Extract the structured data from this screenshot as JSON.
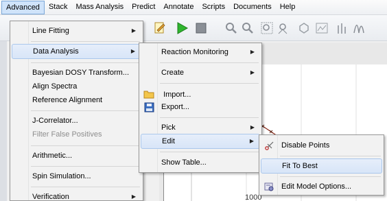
{
  "menubar": {
    "items": [
      "Advanced",
      "Stack",
      "Mass Analysis",
      "Predict",
      "Annotate",
      "Scripts",
      "Documents",
      "Help"
    ],
    "active": "Advanced"
  },
  "plot": {
    "y_tick_label": "1000"
  },
  "advanced_menu": {
    "items": [
      {
        "label": "Line Fitting"
      },
      {
        "label": "Data Analysis"
      },
      {
        "label": "Bayesian DOSY Transform..."
      },
      {
        "label": "Align Spectra"
      },
      {
        "label": "Reference Alignment"
      },
      {
        "label": "J-Correlator..."
      },
      {
        "label": "Filter False Positives",
        "disabled": true
      },
      {
        "label": "Arithmetic..."
      },
      {
        "label": "Spin Simulation..."
      },
      {
        "label": "Verification"
      }
    ]
  },
  "data_analysis_menu": {
    "items": [
      {
        "label": "Reaction Monitoring"
      },
      {
        "label": "Create"
      },
      {
        "label": "Import...",
        "icon": "folder-icon"
      },
      {
        "label": "Export...",
        "icon": "save-icon"
      },
      {
        "label": "Pick"
      },
      {
        "label": "Edit"
      },
      {
        "label": "Show Table..."
      }
    ]
  },
  "edit_menu": {
    "items": [
      {
        "label": "Disable Points",
        "icon": "scissors-icon"
      },
      {
        "label": "Fit To Best"
      },
      {
        "label": "Edit Model Options...",
        "icon": "options-icon"
      }
    ]
  },
  "colors": {
    "highlight": "#cfe3fa",
    "highlight_border": "#7aa7d8",
    "plot_curve": "#8b2b1b"
  }
}
